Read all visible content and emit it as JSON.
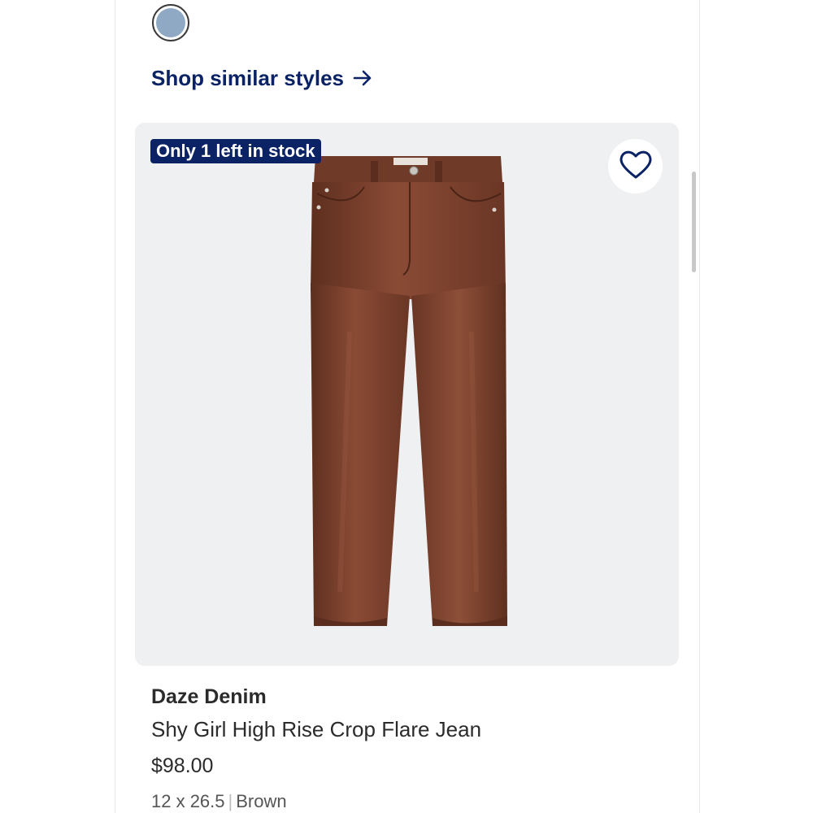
{
  "swatch": {
    "color": "#8fa9c4",
    "selected": true
  },
  "similar_link": {
    "label": "Shop similar styles",
    "icon": "arrow-right-icon"
  },
  "product": {
    "badge": "Only 1 left in stock",
    "favorite_icon": "heart-outline-icon",
    "brand": "Daze Denim",
    "name": "Shy Girl High Rise Crop Flare Jean",
    "price": "$98.00",
    "size": "12 x 26.5",
    "separator": "|",
    "color": "Brown",
    "image_icon": "brown-cropped-jeans-image"
  },
  "colors": {
    "accent": "#0b2365",
    "image_bg": "#eef0f2",
    "jeans": "#7a4330"
  }
}
